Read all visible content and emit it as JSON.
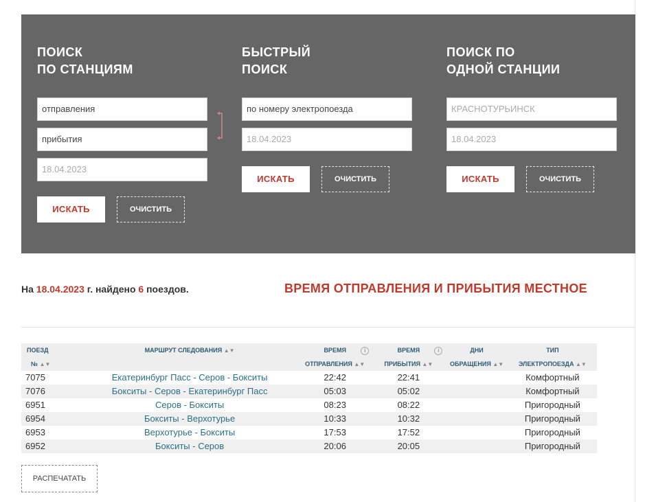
{
  "search_by_stations": {
    "title_line1": "ПОИСК",
    "title_line2": "ПО СТАНЦИЯМ",
    "departure_placeholder": "отправления",
    "arrival_placeholder": "прибытия",
    "date_value": "18.04.2023",
    "search_label": "ИСКАТЬ",
    "clear_label": "ОЧИСТИТЬ"
  },
  "quick_search": {
    "title_line1": "БЫСТРЫЙ",
    "title_line2": "ПОИСК",
    "train_number_placeholder": "по номеру электропоезда",
    "date_value": "18.04.2023",
    "search_label": "ИСКАТЬ",
    "clear_label": "ОЧИСТИТЬ"
  },
  "single_station": {
    "title_line1": "ПОИСК ПО",
    "title_line2": "ОДНОЙ СТАНЦИИ",
    "station_value": "КРАСНОТУРЬИНСК",
    "date_value": "18.04.2023",
    "search_label": "ИСКАТЬ",
    "clear_label": "ОЧИСТИТЬ"
  },
  "result": {
    "prefix": "На",
    "date": "18.04.2023",
    "middle": "г. найдено",
    "count": "6",
    "suffix": "поездов."
  },
  "notice": "ВРЕМЯ ОТПРАВЛЕНИЯ И ПРИБЫТИЯ МЕСТНОЕ",
  "table": {
    "headers": {
      "train_line1": "ПОЕЗД",
      "train_line2": "№",
      "route": "МАРШРУТ СЛЕДОВАНИЯ",
      "dep_line1": "ВРЕМЯ",
      "dep_line2": "ОТПРАВЛЕНИЯ",
      "arr_line1": "ВРЕМЯ",
      "arr_line2": "ПРИБЫТИЯ",
      "days_line1": "ДНИ",
      "days_line2": "ОБРАЩЕНИЯ",
      "type_line1": "ТИП",
      "type_line2": "ЭЛЕКТРОПОЕЗДА"
    },
    "rows": [
      {
        "num": "7075",
        "route": "Екатеринбург Пасс - Серов - Бокситы",
        "dep": "22:42",
        "arr": "22:41",
        "days": "",
        "type": "Комфортный"
      },
      {
        "num": "7076",
        "route": "Бокситы - Серов - Екатеринбург Пасс",
        "dep": "05:03",
        "arr": "05:02",
        "days": "",
        "type": "Комфортный"
      },
      {
        "num": "6951",
        "route": "Серов - Бокситы",
        "dep": "08:23",
        "arr": "08:22",
        "days": "",
        "type": "Пригородный"
      },
      {
        "num": "6954",
        "route": "Бокситы - Верхотурье",
        "dep": "10:33",
        "arr": "10:32",
        "days": "",
        "type": "Пригородный"
      },
      {
        "num": "6953",
        "route": "Верхотурье - Бокситы",
        "dep": "17:53",
        "arr": "17:52",
        "days": "",
        "type": "Пригородный"
      },
      {
        "num": "6952",
        "route": "Бокситы - Серов",
        "dep": "20:06",
        "arr": "20:05",
        "days": "",
        "type": "Пригородный"
      }
    ]
  },
  "print_label": "РАСПЕЧАТАТЬ",
  "colors": {
    "panel": "#666666",
    "accent": "#c0392b",
    "link": "#2a6f86"
  },
  "icons": {
    "swap": "swap-arrows-icon",
    "info": "info-icon",
    "sort": "sort-arrows-icon"
  }
}
